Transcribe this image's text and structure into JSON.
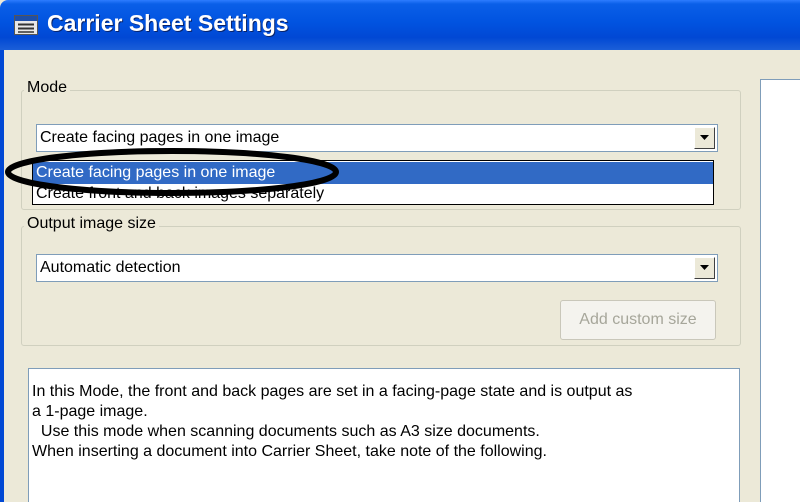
{
  "window": {
    "title": "Carrier Sheet Settings"
  },
  "mode": {
    "legend": "Mode",
    "selected": "Create facing pages in one image",
    "options": [
      "Create facing pages in one image",
      "Create front and back images separately"
    ]
  },
  "output_size": {
    "legend": "Output image size",
    "selected": "Automatic detection",
    "add_custom_label": "Add custom size"
  },
  "description": {
    "lines": [
      "In this Mode, the front and back pages are set in a facing-page state and is output as",
      "a 1-page image.",
      "  Use this mode when scanning documents such as A3 size documents.",
      "",
      "When inserting a document into Carrier Sheet, take note of the following."
    ]
  },
  "colors": {
    "titlebar": "#0153e0",
    "selection": "#316ac5",
    "dialog_bg": "#ece9d8"
  },
  "icons": [
    "window-menu-icon",
    "chevron-down-icon"
  ]
}
